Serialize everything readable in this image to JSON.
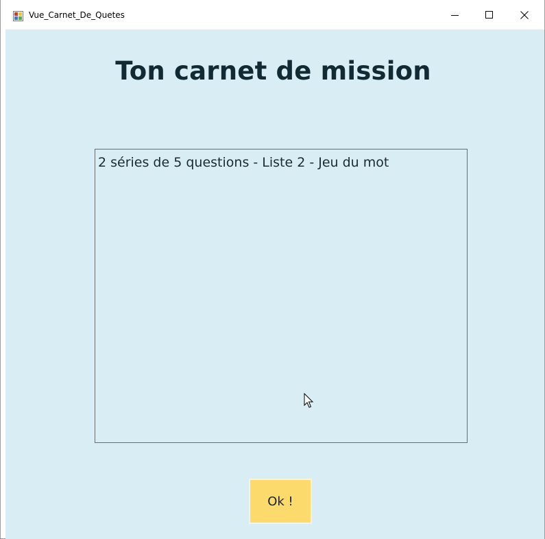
{
  "window": {
    "title": "Vue_Carnet_De_Quetes",
    "controls": {
      "minimize": "minimize-icon",
      "maximize": "maximize-icon",
      "close": "close-icon"
    }
  },
  "main": {
    "heading": "Ton carnet de mission",
    "missions": [
      "2 séries de 5 questions - Liste 2 - Jeu du mot"
    ],
    "ok_label": "Ok !"
  },
  "colors": {
    "background": "#d9edf4",
    "button": "#fcda6b",
    "heading": "#122a33"
  }
}
